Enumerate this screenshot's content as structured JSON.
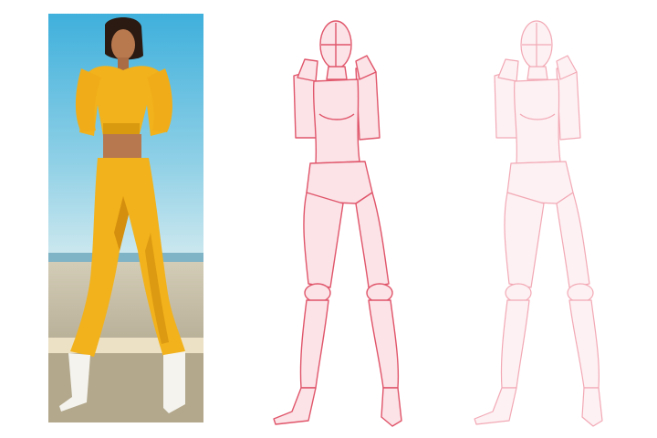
{
  "figure": {
    "panels": [
      {
        "name": "reference-photo",
        "kind": "photo"
      },
      {
        "name": "pose-sketch",
        "kind": "line-drawing",
        "stroke_color": "#e0556a",
        "fill_color": "#fbe3e7"
      },
      {
        "name": "pose-sketch-faded",
        "kind": "line-drawing",
        "stroke_color": "#f2a9b5",
        "fill_color": "#fdf1f3"
      }
    ],
    "colors": {
      "sky_top": "#4fb9de",
      "sky_bottom": "#bfe4ef",
      "sea": "#6fa9c2",
      "pavement": "#c9c2ae",
      "curb": "#e8dcc0",
      "outfit": "#f2b21b",
      "outfit_shadow": "#d48f0e",
      "skin": "#b5764f",
      "hair": "#2a1a12",
      "boots": "#f2f2ee"
    }
  }
}
